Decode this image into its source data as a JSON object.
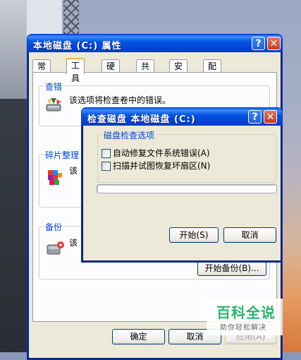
{
  "props_window": {
    "title": "本地磁盘 (C:) 属性",
    "help_btn": "?",
    "close_btn": "✕",
    "tabs": [
      {
        "label": "常规"
      },
      {
        "label": "工具"
      },
      {
        "label": "硬件"
      },
      {
        "label": "共享"
      },
      {
        "label": "安全"
      },
      {
        "label": "配额"
      }
    ],
    "active_tab": "工具",
    "errcheck": {
      "label": "查错",
      "text": "该选项将检查卷中的错误。"
    },
    "defrag": {
      "label": "碎片整理",
      "text_partial": "该"
    },
    "backup": {
      "label": "备份",
      "text_partial": "该",
      "button": "开始备份(B)..."
    },
    "ok_btn": "确定",
    "cancel_btn": "取消",
    "apply_btn": "应用(A)"
  },
  "chkdsk_dialog": {
    "title": "检查磁盘 本地磁盘 (C:)",
    "help_btn": "?",
    "close_btn": "✕",
    "options_label": "磁盘检查选项",
    "option1": "自动修复文件系统错误(A)",
    "option1_checked": false,
    "option2": "扫描并试图恢复坏扇区(N)",
    "option2_checked": false,
    "progress": 0,
    "start_btn": "开始(S)",
    "cancel_btn": "取消"
  },
  "watermark": {
    "main": "百科全说",
    "sub": "助你轻松解决"
  },
  "colors": {
    "titlebar": "#0554e3",
    "dialog_bg": "#ece9d8",
    "group_label": "#0046d5"
  }
}
